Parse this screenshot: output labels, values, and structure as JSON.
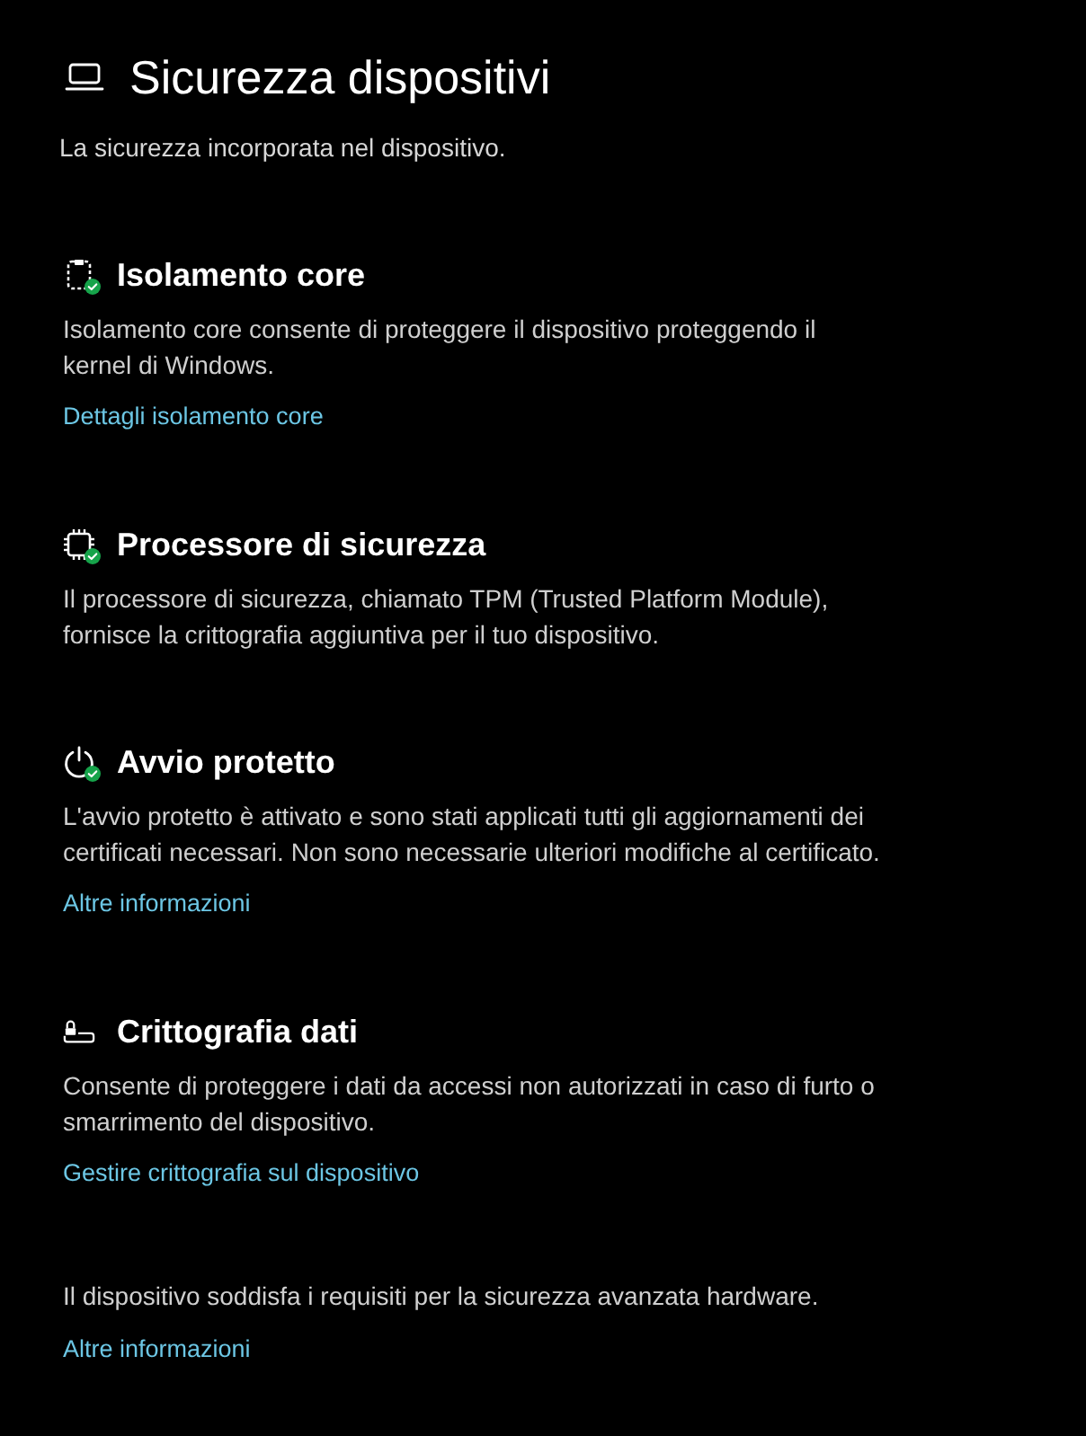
{
  "page": {
    "title": "Sicurezza dispositivi",
    "subtitle": "La sicurezza incorporata nel dispositivo."
  },
  "sections": [
    {
      "heading": "Isolamento core",
      "verified": true,
      "description": "Isolamento core consente di proteggere il dispositivo proteggendo il\nkernel di Windows.",
      "link": "Dettagli isolamento core"
    },
    {
      "heading": "Processore di sicurezza",
      "verified": true,
      "description": "Il processore di sicurezza, chiamato TPM (Trusted Platform Module),\nfornisce la crittografia aggiuntiva per il tuo dispositivo."
    },
    {
      "heading": "Avvio protetto",
      "verified": true,
      "description": "L'avvio protetto è attivato e sono stati applicati tutti gli aggiornamenti dei\ncertificati necessari. Non sono necessarie ulteriori modifiche al certificato.",
      "link": "Altre informazioni"
    },
    {
      "heading": "Crittografia dati",
      "verified": false,
      "description": "Consente di proteggere i dati da accessi non autorizzati in caso di furto o\nsmarrimento del dispositivo.",
      "link": "Gestire crittografia sul dispositivo"
    }
  ],
  "footer": {
    "text": "Il dispositivo soddisfa i requisiti per la sicurezza avanzata hardware.",
    "link": "Altre informazioni"
  }
}
